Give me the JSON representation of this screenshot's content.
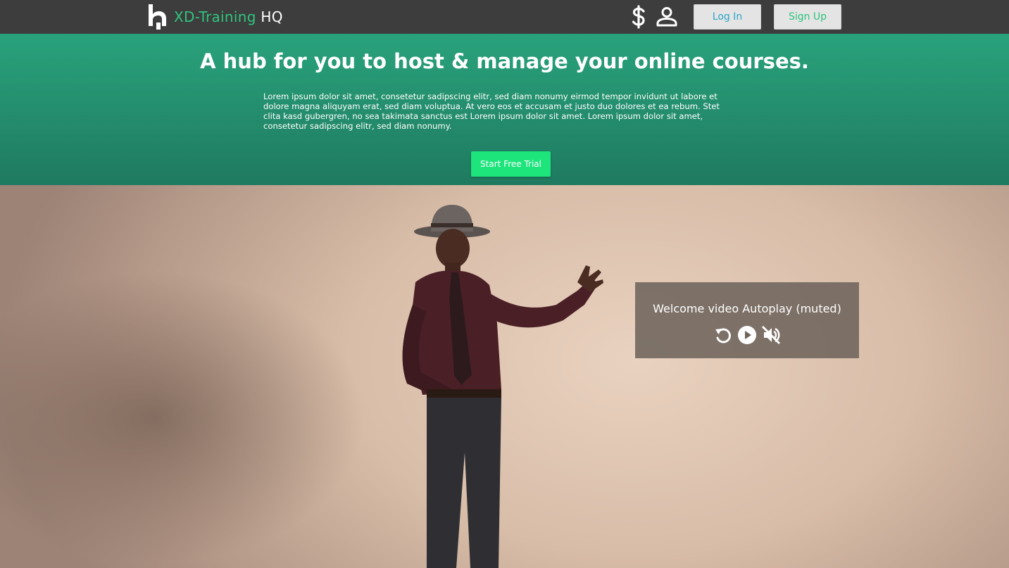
{
  "header": {
    "brand_primary": "XD-Training",
    "brand_secondary": "HQ",
    "logo_icon": "xd-logo-icon",
    "pricing_icon": "dollar-icon",
    "account_icon": "user-icon",
    "login_label": "Log In",
    "signup_label": "Sign Up"
  },
  "hero": {
    "title": "A hub for you to host & manage your online courses.",
    "body": "Lorem ipsum dolor sit amet, consetetur sadipscing elitr, sed diam nonumy eirmod tempor invidunt ut labore et dolore magna aliquyam erat, sed diam voluptua. At vero eos et accusam et justo duo dolores et ea rebum. Stet clita kasd gubergren, no sea takimata sanctus est Lorem ipsum dolor sit amet. Lorem ipsum dolor sit amet, consetetur sadipscing elitr, sed diam nonumy.",
    "cta_label": "Start Free Trial"
  },
  "video": {
    "overlay_text": "Welcome video Autoplay (muted)",
    "controls": [
      "replay-icon",
      "play-icon",
      "mute-icon"
    ]
  },
  "colors": {
    "brand_green": "#2fc47e",
    "login_blue": "#2aa6c5",
    "cta_green": "#1de57c",
    "hero_top": "#29a27c",
    "hero_bottom": "#1f7a5f",
    "nav_bg": "#3d3d3d"
  }
}
